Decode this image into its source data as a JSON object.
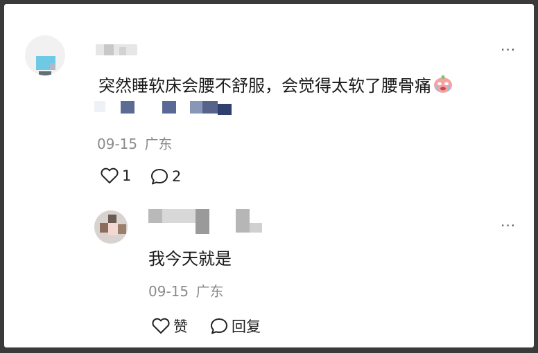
{
  "comment": {
    "text": "突然睡软床会腰不舒服，会觉得太软了腰骨痛",
    "emoji_icon": "crying-face-icon",
    "date": "09-15",
    "location": "广东",
    "like_count": "1",
    "reply_count": "2",
    "more_icon": "ellipsis-icon"
  },
  "reply": {
    "text": "我今天就是",
    "date": "09-15",
    "location": "广东",
    "like_label": "赞",
    "reply_label": "回复",
    "more_icon": "ellipsis-icon"
  },
  "colors": {
    "text": "#1a1a1a",
    "meta": "#8a8a8a",
    "avatar_accent": "#6ec9e4",
    "blur_blue": "#4d5f8a"
  }
}
